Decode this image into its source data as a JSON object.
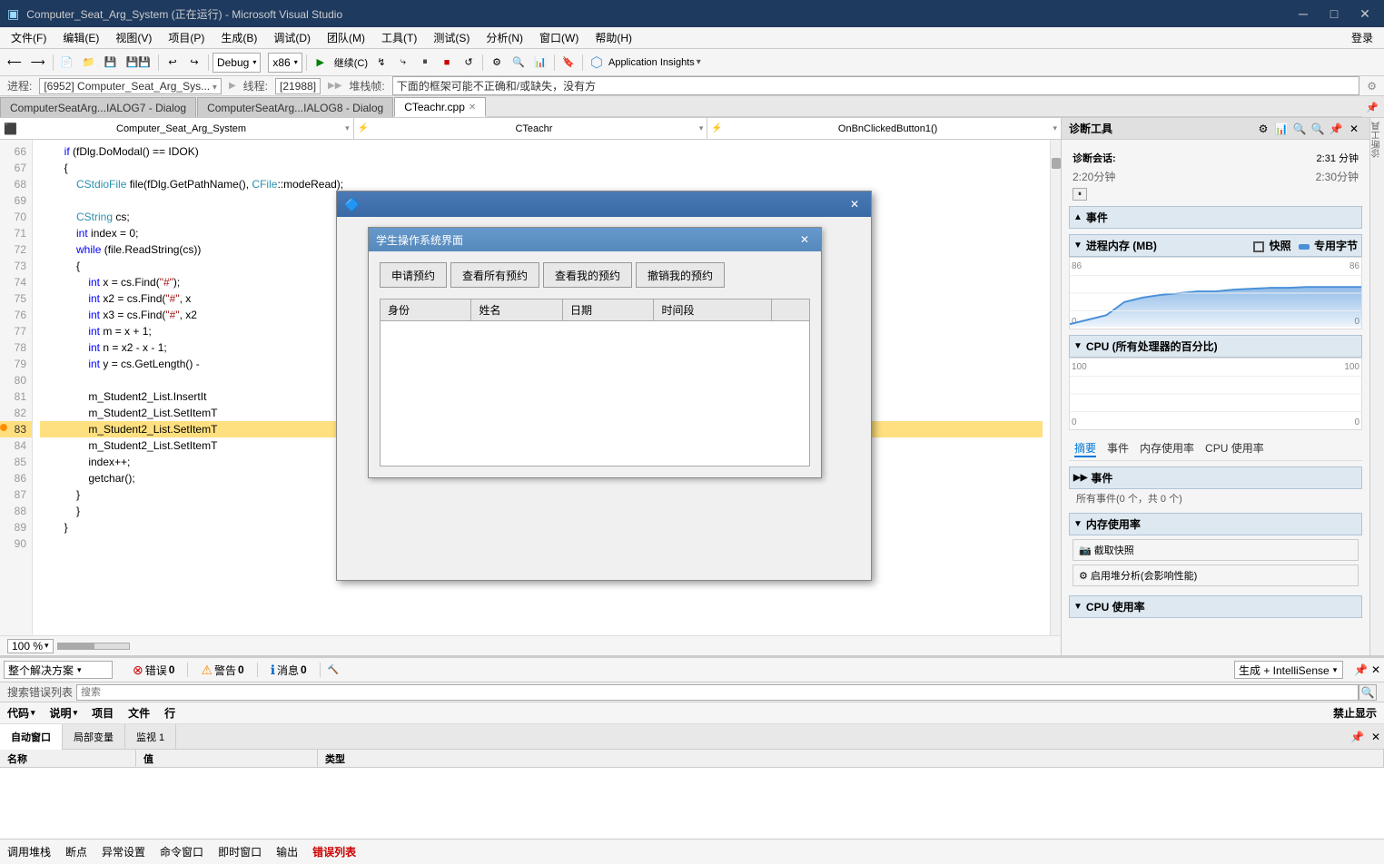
{
  "window": {
    "title": "Computer_Seat_Arg_System (正在运行) - Microsoft Visual Studio",
    "close_label": "✕",
    "maximize_label": "□",
    "minimize_label": "─"
  },
  "menu": {
    "items": [
      "文件(F)",
      "编辑(E)",
      "视图(V)",
      "项目(P)",
      "生成(B)",
      "调试(D)",
      "团队(M)",
      "工具(T)",
      "测试(S)",
      "分析(N)",
      "窗口(W)",
      "帮助(H)"
    ]
  },
  "toolbar": {
    "debug_config": "Debug",
    "platform": "x86",
    "continue": "继续(C)",
    "login": "登录",
    "application_insights": "Application Insights"
  },
  "progress": {
    "label": "进程:",
    "value": "[6952] Computer_Seat_Arg_Sys...",
    "thread_label": "线程:",
    "thread_value": "[21988]",
    "stack_label": "堆栈帧:",
    "stack_value": "下面的框架可能不正确和/或缺失，没有方"
  },
  "tabs": {
    "items": [
      {
        "label": "ComputerSeatArg...IALOG7 - Dialog",
        "active": false,
        "closable": false
      },
      {
        "label": "ComputerSeatArg...IALOG8 - Dialog",
        "active": false,
        "closable": false
      },
      {
        "label": "CTeachr.cpp",
        "active": true,
        "closable": true
      }
    ]
  },
  "editor": {
    "class_dropdown": "Computer_Seat_Arg_System",
    "method_dropdown": "CTeachr",
    "function_dropdown": "OnBnClickedButton1()",
    "lines": [
      {
        "num": 66,
        "code": "        if (fDlg.DoModal() == IDOK)",
        "indent": 8,
        "highlight": false
      },
      {
        "num": 67,
        "code": "        {",
        "indent": 8,
        "highlight": false
      },
      {
        "num": 68,
        "code": "            CStdioFile file(fDlg.GetPathName(), CFile::modeRead);",
        "indent": 12,
        "highlight": false
      },
      {
        "num": 69,
        "code": "",
        "indent": 0,
        "highlight": false
      },
      {
        "num": 70,
        "code": "            CString cs;",
        "indent": 12,
        "highlight": false
      },
      {
        "num": 71,
        "code": "            int index = 0;",
        "indent": 12,
        "highlight": false
      },
      {
        "num": 72,
        "code": "            while (file.ReadString(cs))",
        "indent": 12,
        "highlight": false
      },
      {
        "num": 73,
        "code": "            {",
        "indent": 12,
        "highlight": false
      },
      {
        "num": 74,
        "code": "                int x = cs.Find(\"#\");",
        "indent": 16,
        "highlight": false
      },
      {
        "num": 75,
        "code": "                int x2 = cs.Find(\"#\", x",
        "indent": 16,
        "highlight": false
      },
      {
        "num": 76,
        "code": "                int x3 = cs.Find(\"#\", x2",
        "indent": 16,
        "highlight": false
      },
      {
        "num": 77,
        "code": "                int m = x + 1;",
        "indent": 16,
        "highlight": false
      },
      {
        "num": 78,
        "code": "                int n = x2 - x - 1;",
        "indent": 16,
        "highlight": false
      },
      {
        "num": 79,
        "code": "                int y = cs.GetLength() -",
        "indent": 16,
        "highlight": false
      },
      {
        "num": 80,
        "code": "",
        "indent": 0,
        "highlight": false
      },
      {
        "num": 81,
        "code": "                m_Student2_List.InsertIt",
        "indent": 16,
        "highlight": false
      },
      {
        "num": 82,
        "code": "                m_Student2_List.SetItemT",
        "indent": 16,
        "highlight": false
      },
      {
        "num": 83,
        "code": "                m_Student2_List.SetItemT",
        "indent": 16,
        "highlight": true,
        "has_breakpoint": true
      },
      {
        "num": 84,
        "code": "                m_Student2_List.SetItemT",
        "indent": 16,
        "highlight": false
      },
      {
        "num": 85,
        "code": "                index++;",
        "indent": 16,
        "highlight": false
      },
      {
        "num": 86,
        "code": "                getchar();",
        "indent": 16,
        "highlight": false
      },
      {
        "num": 87,
        "code": "            }",
        "indent": 12,
        "highlight": false
      },
      {
        "num": 88,
        "code": "            }",
        "indent": 8,
        "highlight": false
      },
      {
        "num": 89,
        "code": "        }",
        "indent": 4,
        "highlight": false
      },
      {
        "num": 90,
        "code": "",
        "indent": 0,
        "highlight": false
      }
    ],
    "zoom": "100 %"
  },
  "diagnostics": {
    "title": "诊断工具",
    "session_label": "诊断会话:",
    "session_time": "2:31 分钟",
    "time_start": "2:20分钟",
    "time_end": "2:30分钟",
    "pause_btn": "⏸",
    "sections": {
      "event": {
        "title": "事件",
        "collapse_arrow": "▲"
      },
      "memory": {
        "title": "进程内存 (MB)",
        "collapse_arrow": "▼",
        "snapshot_label": "快照",
        "private_bytes_label": "专用字节",
        "axis_max": "86",
        "axis_min": "0",
        "axis_max_right": "86",
        "axis_min_right": "0"
      },
      "cpu": {
        "title": "CPU (所有处理器的百分比)",
        "collapse_arrow": "▼",
        "axis_max": "100",
        "axis_min": "0",
        "axis_max_right": "100",
        "axis_min_right": "0"
      }
    },
    "bottom_tabs": [
      "摘要",
      "事件",
      "内存使用率",
      "CPU 使用率"
    ],
    "active_bottom_tab": "摘要",
    "events_section": {
      "title": "事件",
      "items_label": "所有事件(0 个，共 0 个)"
    },
    "memory_section": {
      "title": "内存使用率",
      "snapshot_btn": "📷  截取快照",
      "heap_btn": "⚙  启用堆分析(会影响性能)"
    },
    "cpu_section": {
      "title": "CPU 使用率"
    }
  },
  "bottom": {
    "tabs": [
      "自动窗口",
      "局部变量",
      "监视 1"
    ],
    "active_tab": "自动窗口",
    "auto_window": {
      "title": "自动窗口",
      "columns": [
        "名称",
        "值",
        "类型"
      ]
    },
    "error_bar": {
      "scope_label": "整个解决方案",
      "error_label": "错误",
      "error_count": "0",
      "warning_label": "警告",
      "warning_count": "0",
      "message_label": "消息",
      "message_count": "0",
      "build_label": "生成 + IntelliSense"
    },
    "error_list_search": "搜索错误列表",
    "error_cols": [
      "代码",
      "说明",
      "项目",
      "文件",
      "行",
      "禁止显示"
    ],
    "status_items": [
      "调用堆栈",
      "断点",
      "异常设置",
      "命令窗口",
      "即时窗口",
      "输出",
      "错误列表"
    ]
  },
  "outer_dialog": {
    "icon": "🟦",
    "title": ""
  },
  "inner_dialog": {
    "title": "学生操作系统界面",
    "close_label": "✕",
    "buttons": [
      "申请预约",
      "查看所有预约",
      "查看我的预约",
      "撤销我的预约"
    ],
    "table_headers": [
      "身份",
      "姓名",
      "日期",
      "时间段"
    ]
  }
}
